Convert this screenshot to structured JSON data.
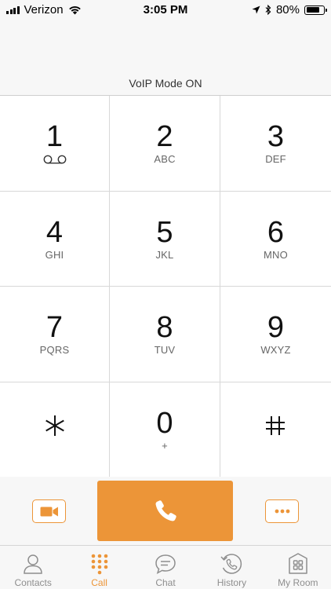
{
  "status_bar": {
    "carrier": "Verizon",
    "time": "3:05 PM",
    "battery": "80%",
    "battery_level": 0.8,
    "icons": [
      "signal-icon",
      "wifi-icon",
      "location-icon",
      "bluetooth-icon",
      "battery-icon"
    ]
  },
  "dialer": {
    "voip_mode": "VoIP Mode ON"
  },
  "keypad": [
    {
      "digit": "1",
      "letters": ""
    },
    {
      "digit": "2",
      "letters": "ABC"
    },
    {
      "digit": "3",
      "letters": "DEF"
    },
    {
      "digit": "4",
      "letters": "GHI"
    },
    {
      "digit": "5",
      "letters": "JKL"
    },
    {
      "digit": "6",
      "letters": "MNO"
    },
    {
      "digit": "7",
      "letters": "PQRS"
    },
    {
      "digit": "8",
      "letters": "TUV"
    },
    {
      "digit": "9",
      "letters": "WXYZ"
    },
    {
      "digit": "*",
      "letters": ""
    },
    {
      "digit": "0",
      "letters": "+"
    },
    {
      "digit": "#",
      "letters": ""
    }
  ],
  "actions": {
    "accent_color": "#ec9538",
    "icons": [
      "video-camera-icon",
      "phone-icon",
      "more-icon"
    ]
  },
  "tabs": [
    {
      "label": "Contacts",
      "icon": "person-icon",
      "active": false
    },
    {
      "label": "Call",
      "icon": "keypad-icon",
      "active": true
    },
    {
      "label": "Chat",
      "icon": "chat-bubble-icon",
      "active": false
    },
    {
      "label": "History",
      "icon": "history-icon",
      "active": false
    },
    {
      "label": "My Room",
      "icon": "room-icon",
      "active": false
    }
  ]
}
